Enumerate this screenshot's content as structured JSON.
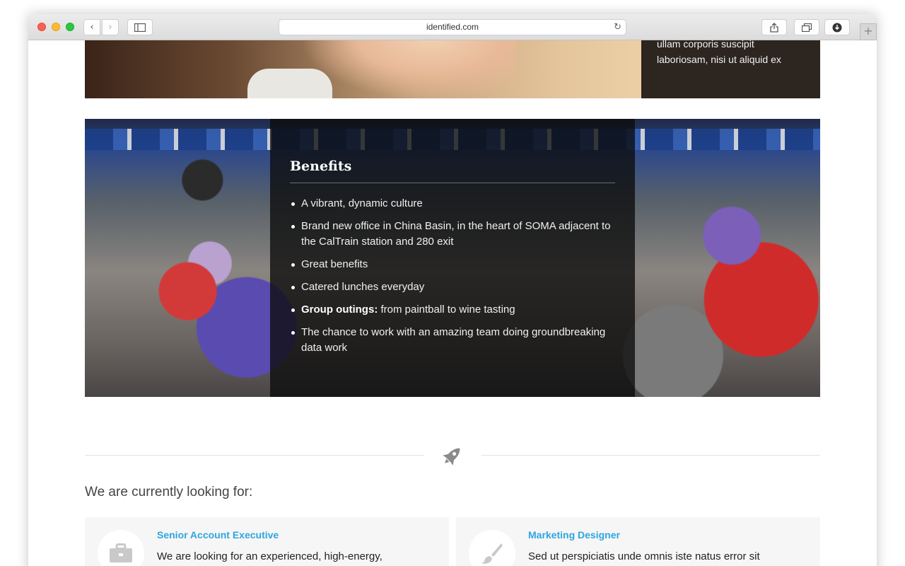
{
  "browser": {
    "url": "identified.com",
    "back_glyph": "‹",
    "forward_glyph": "›",
    "reload_glyph": "↻",
    "new_tab_glyph": "+"
  },
  "hero": {
    "caption": "ullam corporis suscipit laboriosam, nisi ut aliquid ex"
  },
  "benefits": {
    "title": "Benefits",
    "items": [
      {
        "bold": "",
        "text": "A vibrant, dynamic culture"
      },
      {
        "bold": "",
        "text": "Brand new office in China Basin, in the heart of SOMA adjacent to the CalTrain station and 280 exit"
      },
      {
        "bold": "",
        "text": "Great benefits"
      },
      {
        "bold": "",
        "text": "Catered lunches everyday"
      },
      {
        "bold": "Group outings:",
        "text": " from paintball to wine tasting"
      },
      {
        "bold": "",
        "text": "The chance to work with an amazing team doing groundbreaking data work"
      }
    ]
  },
  "careers": {
    "heading": "We are currently looking for:",
    "jobs": [
      {
        "title": "Senior Account Executive",
        "description": "We are looking for an experienced, high-energy, competitive person to fill out our new batch of recruits.",
        "icon": "briefcase-icon"
      },
      {
        "title": "Marketing Designer",
        "description": "Sed ut perspiciatis unde omnis iste natus error sit voluptatem accusantium",
        "icon": "paintbrush-icon"
      }
    ]
  },
  "colors": {
    "accent": "#2ea6e0",
    "panel": "#0c0c0c"
  }
}
